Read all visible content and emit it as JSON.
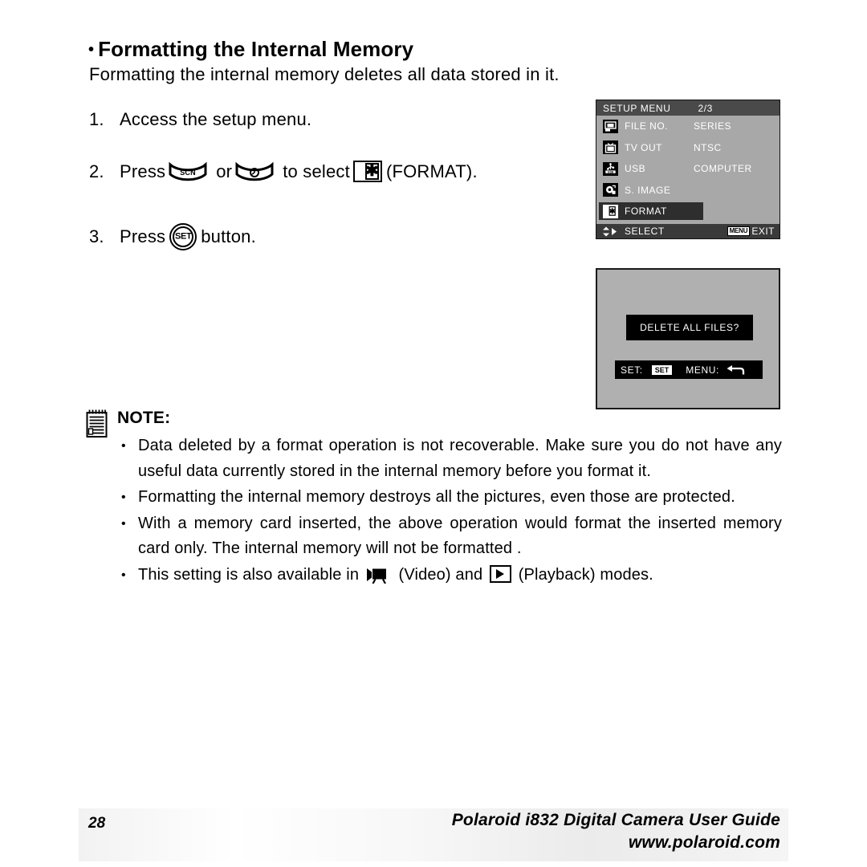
{
  "heading": {
    "bullet": "•",
    "title": "Formatting the Internal Memory"
  },
  "intro": "Formatting the internal memory deletes all data stored in it.",
  "steps": [
    {
      "number": "1.",
      "text": "Access the setup menu."
    },
    {
      "number": "2.",
      "press_label": "Press",
      "or_label": "or",
      "to_select_label": "to select",
      "target_label": "(FORMAT).",
      "icon_a": "scn-button-icon",
      "icon_b": "self-timer-button-icon",
      "icon_c": "format-icon"
    },
    {
      "number": "3.",
      "press_label": "Press",
      "button_label": "button.",
      "icon": "set-button-icon",
      "icon_text": "SET"
    }
  ],
  "lcd_menu": {
    "title": "SETUP MENU",
    "page": "2/3",
    "rows": [
      {
        "icon": "file-number-icon",
        "name": "FILE NO.",
        "value": "SERIES",
        "selected": false
      },
      {
        "icon": "tv-out-icon",
        "name": "TV OUT",
        "value": "NTSC",
        "selected": false
      },
      {
        "icon": "usb-icon",
        "name": "USB",
        "value": "COMPUTER",
        "selected": false
      },
      {
        "icon": "s-image-icon",
        "name": "S. IMAGE",
        "value": "",
        "selected": false
      },
      {
        "icon": "format-icon",
        "name": "FORMAT",
        "value": "",
        "selected": true
      }
    ],
    "status": {
      "select_label": "SELECT",
      "menu_badge": "MENU",
      "exit_label": "EXIT"
    }
  },
  "lcd_dialog": {
    "message": "DELETE ALL FILES?",
    "set_label": "SET:",
    "set_badge": "SET",
    "menu_label": "MENU:"
  },
  "note": {
    "title": "NOTE:",
    "icon": "notepad-icon",
    "items": [
      {
        "text": "Data deleted by a format operation is not recoverable. Make sure you do not have any useful data currently stored in the internal memory before you format it."
      },
      {
        "text": "Formatting the internal memory destroys all the pictures, even those are protected."
      },
      {
        "text": "With a memory card inserted, the above operation would format the inserted memory card only. The internal memory will not be formatted ."
      },
      {
        "lead": "This setting is also available in",
        "video_label": "(Video)",
        "and_label": "and",
        "playback_label": "(Playback)",
        "tail": "modes.",
        "icon_video": "video-mode-icon",
        "icon_playback": "playback-mode-icon"
      }
    ]
  },
  "footer": {
    "page_number": "28",
    "guide": "Polaroid i832 Digital Camera User Guide",
    "url": "www.polaroid.com"
  },
  "colors": {
    "lcd_background": "#a8a8a8",
    "lcd_title_bar": "#4a4a4a",
    "lcd_highlight": "#2e2e2e",
    "dialog_background": "#b0b0b0",
    "text": "#000000"
  }
}
